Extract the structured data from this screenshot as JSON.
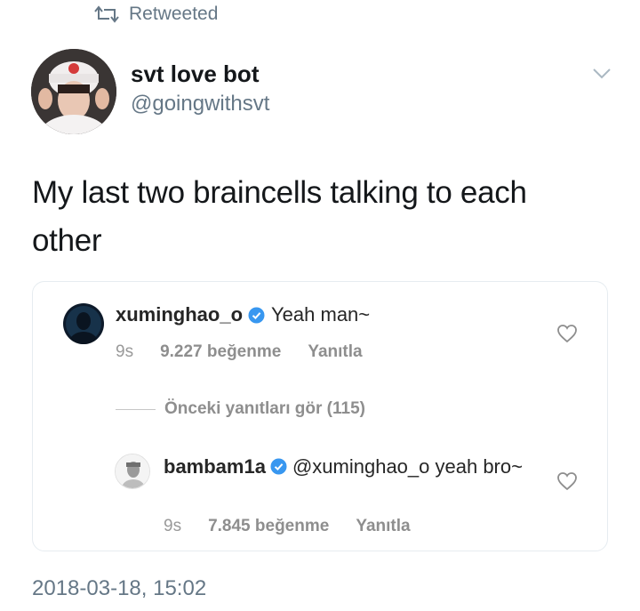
{
  "retweet": {
    "icon": "retweet-icon",
    "label": "Retweeted"
  },
  "author": {
    "name": "svt love bot",
    "handle": "@goingwithsvt",
    "avatar": "profile-photo"
  },
  "tweet": {
    "text": "My last two braincells talking to each other",
    "menu_icon": "chevron-down-icon"
  },
  "embedded_comments": {
    "comment1": {
      "username": "xuminghao_o",
      "verified": true,
      "text": "Yeah man~",
      "time": "9s",
      "likes": "9.227 beğenme",
      "reply": "Yanıtla"
    },
    "previous_replies": "Önceki yanıtları gör (115)",
    "comment2": {
      "username": "bambam1a",
      "verified": true,
      "text": "@xuminghao_o yeah bro~",
      "time": "9s",
      "likes": "7.845 beğenme",
      "reply": "Yanıtla"
    }
  },
  "timestamp": "2018-03-18, 15:02",
  "colors": {
    "secondary_text": "#657786",
    "verified_blue": "#3897f0",
    "border": "#e6ecf0"
  }
}
